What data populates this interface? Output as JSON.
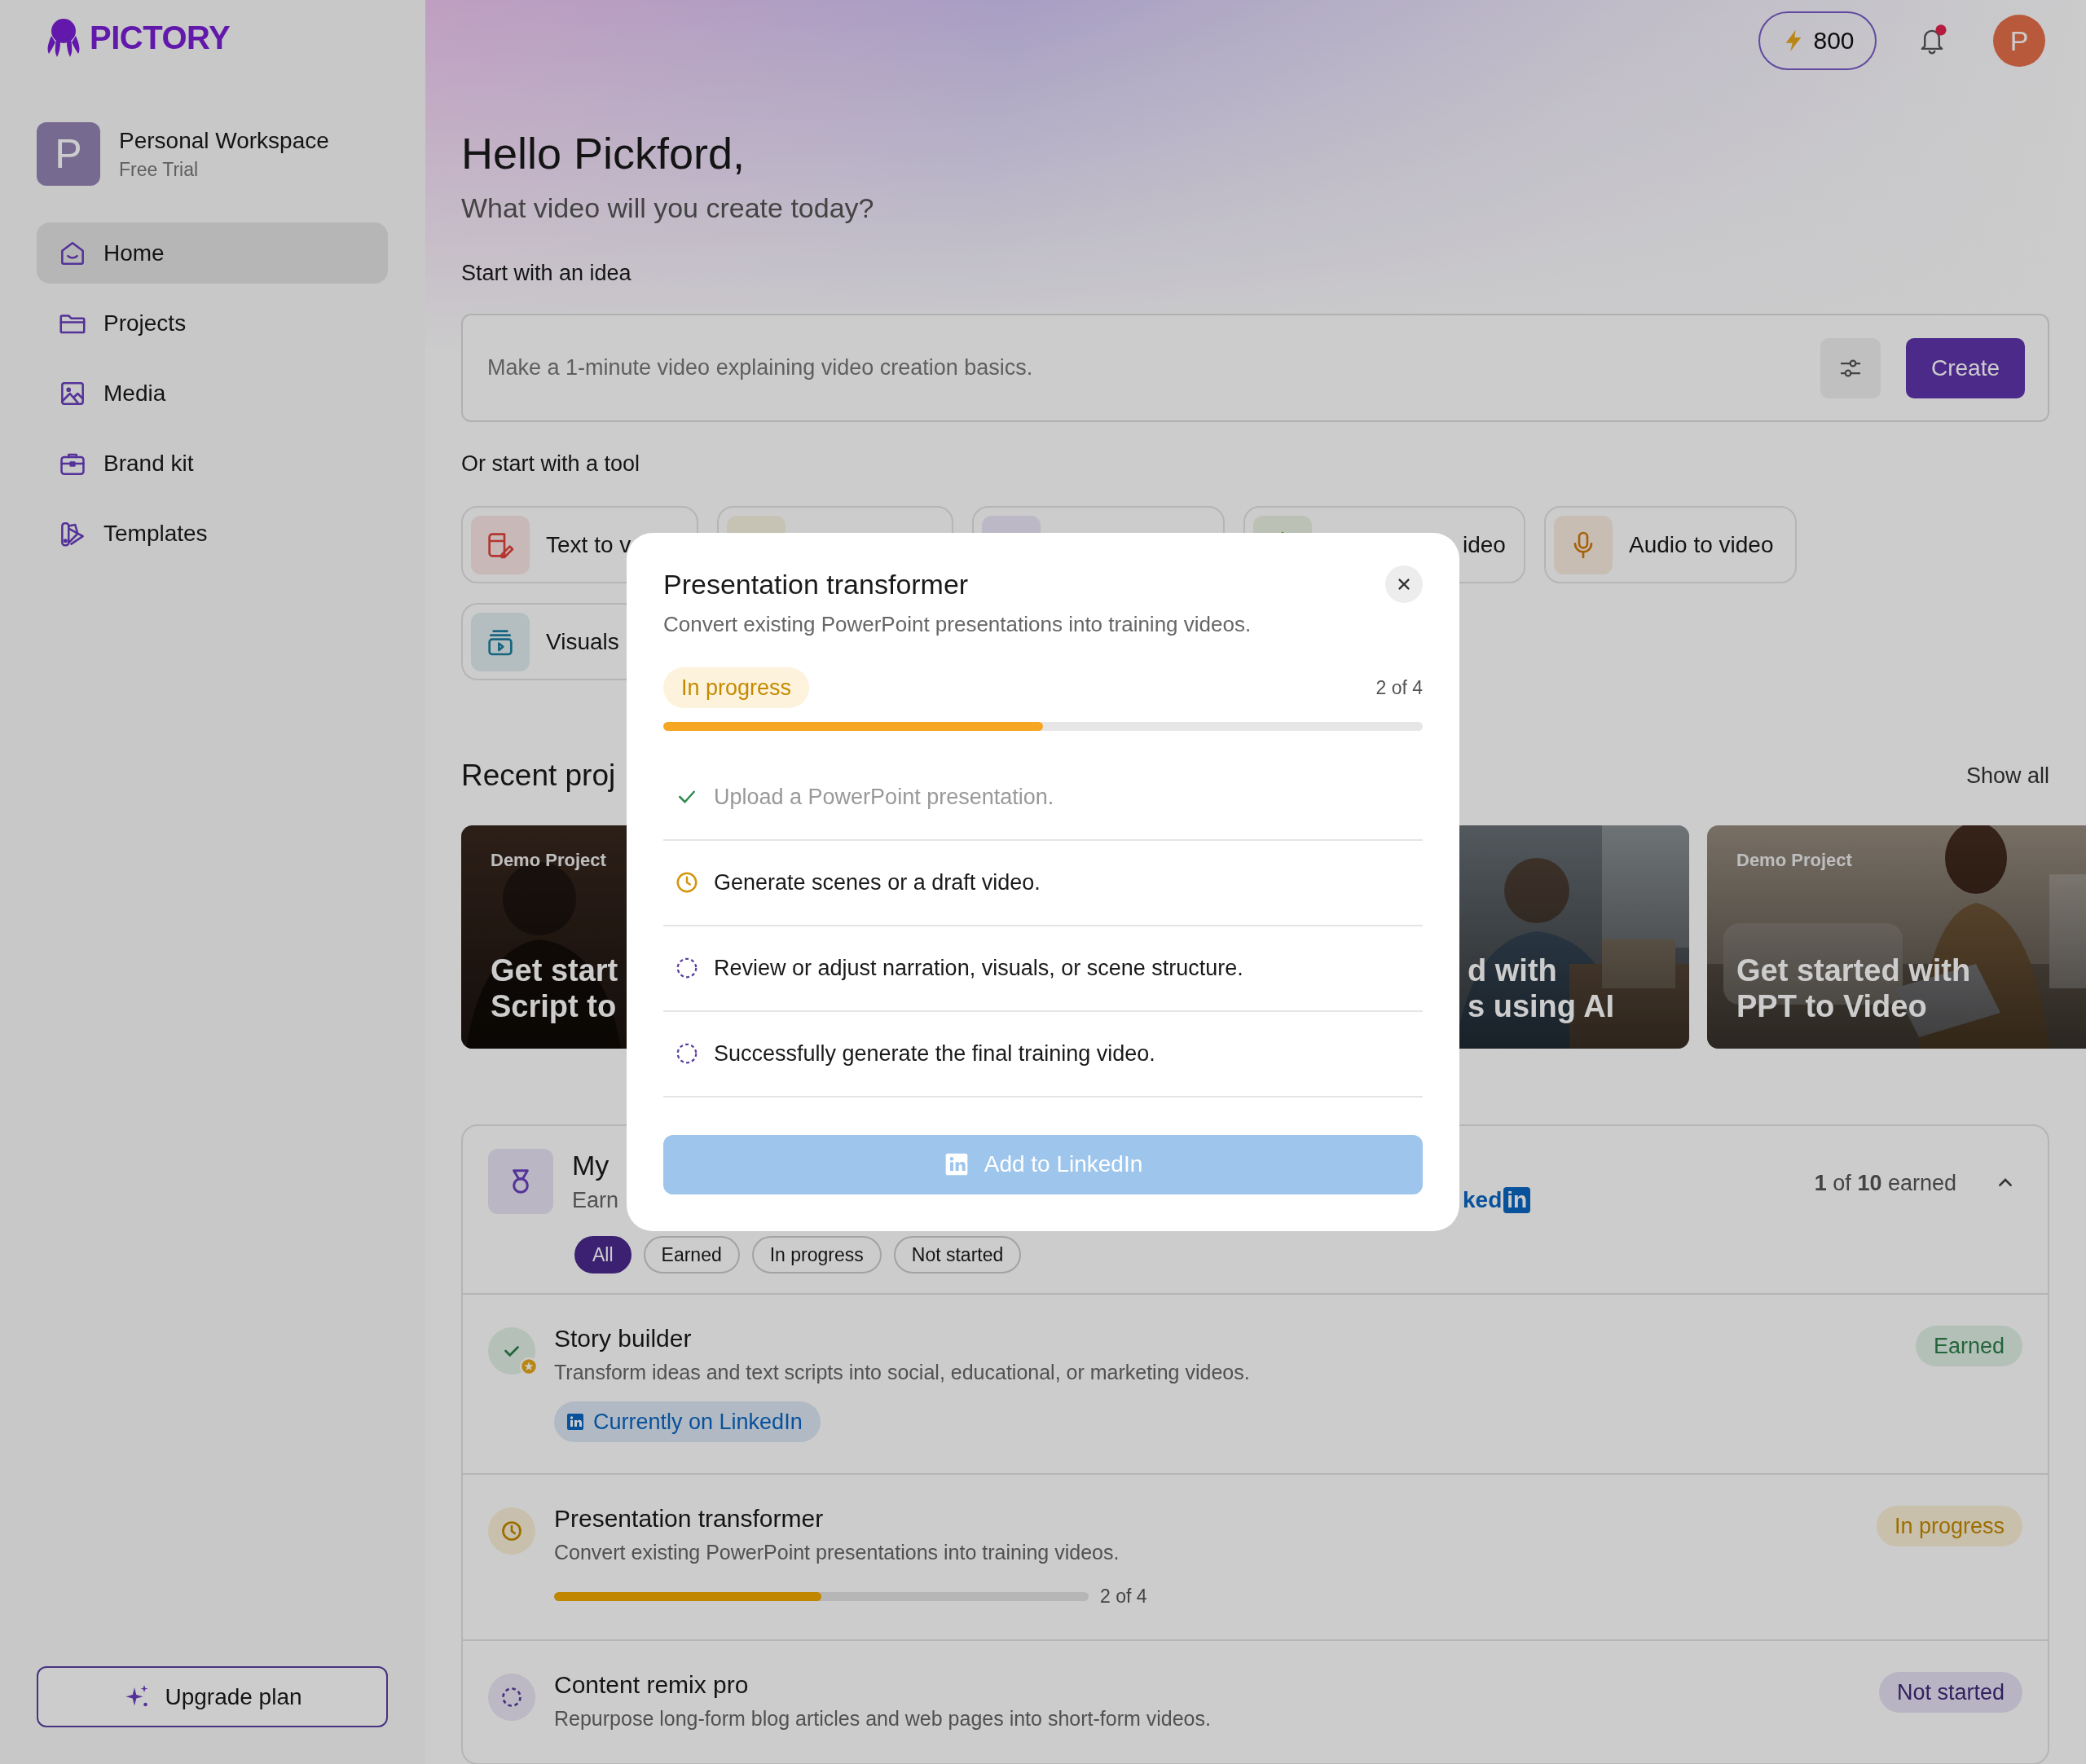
{
  "sidebar": {
    "logo": "PICTORY",
    "workspace": {
      "initial": "P",
      "name": "Personal Workspace",
      "plan": "Free Trial"
    },
    "nav": [
      {
        "label": "Home",
        "selected": true
      },
      {
        "label": "Projects",
        "selected": false
      },
      {
        "label": "Media",
        "selected": false
      },
      {
        "label": "Brand kit",
        "selected": false
      },
      {
        "label": "Templates",
        "selected": false
      }
    ],
    "upgrade_button": "Upgrade plan"
  },
  "topbar": {
    "credits": "800",
    "unread": true,
    "avatar_initial": "P"
  },
  "greeting": "Hello Pickford,",
  "subtitle": "What video will you create today?",
  "idea": {
    "label": "Start with an idea",
    "placeholder": "Make a 1-minute video explaining video creation basics.",
    "create_button": "Create"
  },
  "tools": {
    "label": "Or start with a tool",
    "items": [
      {
        "label": "Text to v"
      },
      {
        "label": "ideo"
      },
      {
        "label": "Audio to video"
      },
      {
        "label": "Visuals"
      }
    ]
  },
  "recent": {
    "title": "Recent proj",
    "show_all": "Show all",
    "cards": [
      {
        "tag": "Demo Project",
        "title_lines": [
          "Get start",
          "Script to"
        ]
      },
      {
        "title_lines": [
          "d with",
          "s using AI"
        ]
      },
      {
        "tag": "Demo Project",
        "title_lines": [
          "Get started with",
          "PPT to Video"
        ]
      }
    ]
  },
  "badges": {
    "title": "My",
    "subtitle": "Earn",
    "logo_text": "ked",
    "logo_badge": "in",
    "summary": "**1** of **10** earned",
    "expanded": true,
    "filters": [
      {
        "label": "All",
        "selected": true
      },
      {
        "label": "Earned",
        "selected": false
      },
      {
        "label": "In progress",
        "selected": false
      },
      {
        "label": "Not started",
        "selected": false
      }
    ],
    "items": [
      {
        "kind": "earned",
        "title": "Story builder",
        "description": "Transform ideas and text scripts into social, educational, or marketing videos.",
        "pill": "Earned",
        "linkedin_chip": "Currently on LinkedIn"
      },
      {
        "kind": "progress",
        "title": "Presentation transformer",
        "description": "Convert existing PowerPoint presentations into training videos.",
        "pill": "In progress",
        "level": 0.5,
        "reading": "2 of 4"
      },
      {
        "kind": "waiting",
        "title": "Content remix pro",
        "description": "Repurpose long-form blog articles and web pages into short-form videos.",
        "pill": "Not started"
      }
    ]
  },
  "modal": {
    "title": "Presentation transformer",
    "description": "Convert existing PowerPoint presentations into training videos.",
    "status_label": "In progress",
    "count": "2 of 4",
    "level": 0.5,
    "steps": [
      {
        "kind": "done",
        "text": "Upload a PowerPoint presentation."
      },
      {
        "kind": "current",
        "text": "Generate scenes or a draft video."
      },
      {
        "kind": "pending",
        "text": "Review or adjust narration, visuals, or scene structure."
      },
      {
        "kind": "pending",
        "text": "Successfully generate the final training video."
      }
    ],
    "button": "Add to LinkedIn"
  }
}
